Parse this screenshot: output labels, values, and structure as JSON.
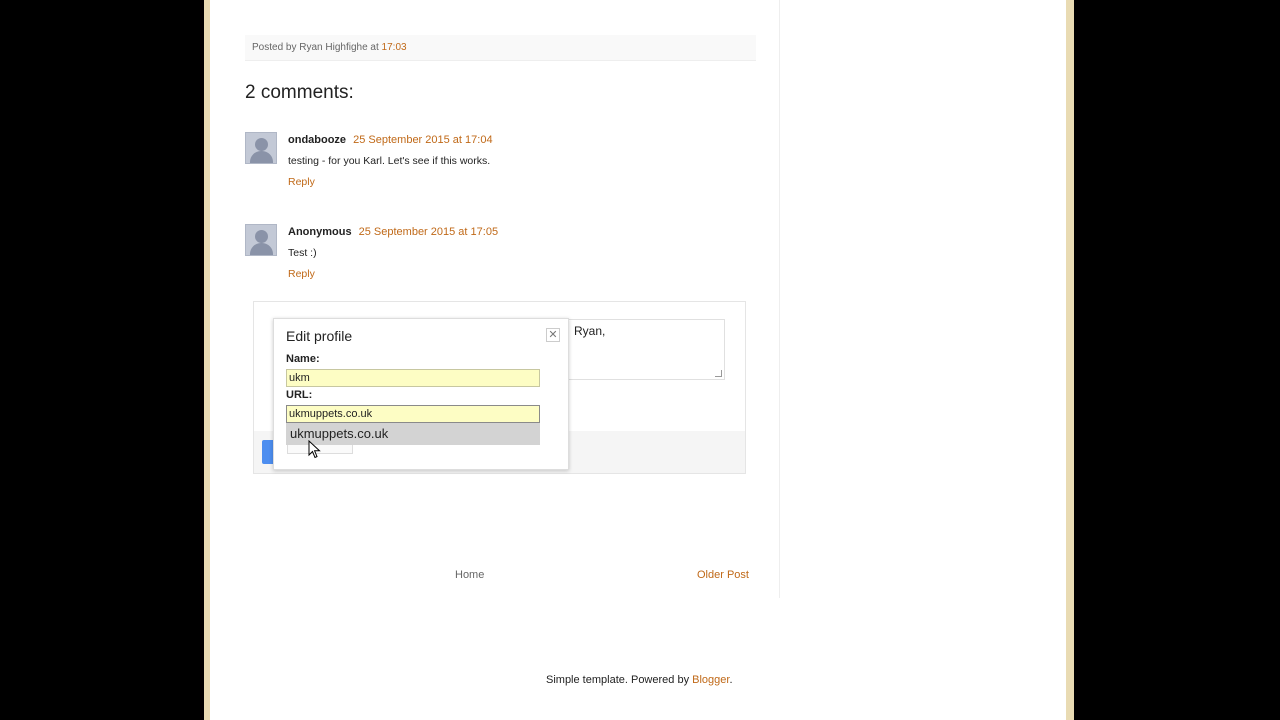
{
  "post_footer": {
    "posted_by_prefix": "Posted by",
    "author": "Ryan Highfighe",
    "at": "at",
    "time": "17:03"
  },
  "comments": {
    "heading": "2 comments:",
    "items": [
      {
        "author": "ondabooze",
        "date": "25 September 2015 at 17:04",
        "text": "testing - for you Karl. Let's see if this works.",
        "reply": "Reply"
      },
      {
        "author": "Anonymous",
        "date": "25 September 2015 at 17:05",
        "text": "Test :)",
        "reply": "Reply"
      }
    ]
  },
  "comment_form": {
    "textarea_text": "Ryan,"
  },
  "edit_profile": {
    "title": "Edit profile",
    "close": "✕",
    "name_label": "Name:",
    "name_value": "ukm",
    "url_label": "URL:",
    "url_value": "ukmuppets.co.uk",
    "autocomplete_suggestion": "ukmuppets.co.uk"
  },
  "pager": {
    "home": "Home",
    "older": "Older Post"
  },
  "footer": {
    "text": "Simple template. Powered by",
    "link": "Blogger",
    "suffix": "."
  },
  "colors": {
    "link": "#c06918",
    "frame": "#e9dbb3",
    "input_bg": "#fdfdc4"
  }
}
